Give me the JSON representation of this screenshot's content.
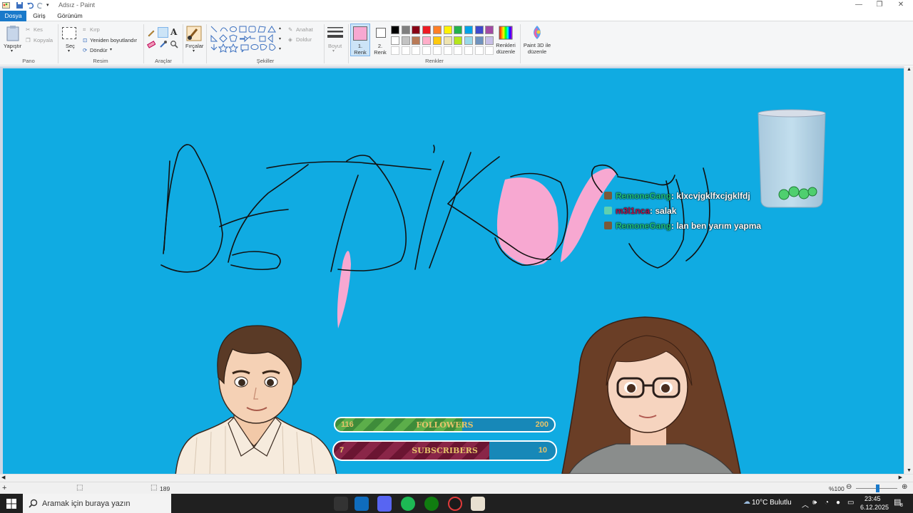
{
  "window": {
    "title": "Adsız - Paint"
  },
  "tabs": [
    {
      "label": "Dosya"
    },
    {
      "label": "Giriş"
    },
    {
      "label": "Görünüm"
    }
  ],
  "ribbon": {
    "pano": {
      "group": "Pano",
      "paste": "Yapıştır",
      "cut": "Kes",
      "copy": "Kopyala"
    },
    "resim": {
      "group": "Resim",
      "select": "Seç",
      "crop": "Kırp",
      "resize": "Yeniden boyutlandır",
      "rotate": "Döndür"
    },
    "araclar": {
      "group": "Araçlar"
    },
    "brushes": {
      "label": "Fırçalar"
    },
    "sekiller": {
      "group": "Şekiller",
      "outline": "Anahat",
      "fill": "Doldur"
    },
    "size": {
      "label": "Boyut"
    },
    "colors": {
      "group": "Renkler",
      "color1": "1. Renk",
      "color2": "2. Renk",
      "edit": "Renkleri düzenle",
      "paint3d": "Paint 3D ile düzenle",
      "color1_value": "#f7a8d1",
      "color2_value": "#ffffff",
      "palette_row1": [
        "#000000",
        "#7f7f7f",
        "#880015",
        "#ed1c24",
        "#ff7f27",
        "#fff200",
        "#22b14c",
        "#00a2e8",
        "#3f48cc",
        "#a349a4"
      ],
      "palette_row2": [
        "#ffffff",
        "#c3c3c3",
        "#b97a57",
        "#ffaec9",
        "#ffc90e",
        "#efe4b0",
        "#b5e61d",
        "#99d9ea",
        "#7092be",
        "#c8bfe7"
      ]
    }
  },
  "canvas": {
    "background": "#10abe2"
  },
  "chat": [
    {
      "user": "RemoneGang",
      "message": ": klxcvjgklfxcjgklfdj",
      "user_color": "#1fc07a"
    },
    {
      "user": "m3l1nca",
      "message": ": salak",
      "user_color": "#b0134a"
    },
    {
      "user": "RemoneGang",
      "message": ": lan ben yarım yapma",
      "user_color": "#1fc07a"
    }
  ],
  "goals": [
    {
      "label": "FOLLOWERS",
      "current": "116",
      "target": "200",
      "progress": 0.58,
      "text_color": "#e5c36a"
    },
    {
      "label": "SUBSCRIBERS",
      "current": "7",
      "target": "10",
      "progress": 0.7,
      "text_color": "#e5c36a"
    }
  ],
  "statusbar": {
    "size": "189",
    "zoom": "%100"
  },
  "taskbar": {
    "search_placeholder": "Aramak için buraya yazın",
    "weather": "10°C  Bulutlu",
    "time": "23:45",
    "date": "6.12.2025",
    "notifications": "8"
  }
}
